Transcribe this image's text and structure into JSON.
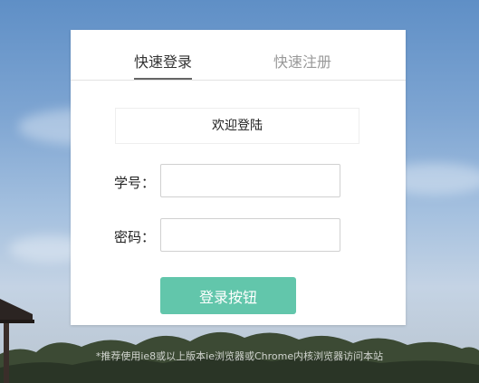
{
  "tabs": {
    "login": "快速登录",
    "register": "快速注册"
  },
  "login_form": {
    "welcome": "欢迎登陆",
    "id_label": "学号：",
    "password_label": "密码：",
    "submit_label": "登录按钮"
  },
  "footer": {
    "note": "*推荐使用ie8或以上版本ie浏览器或Chrome内核浏览器访问本站"
  },
  "colors": {
    "accent": "#62c6ab",
    "tab_active": "#333333",
    "tab_inactive": "#999999"
  }
}
